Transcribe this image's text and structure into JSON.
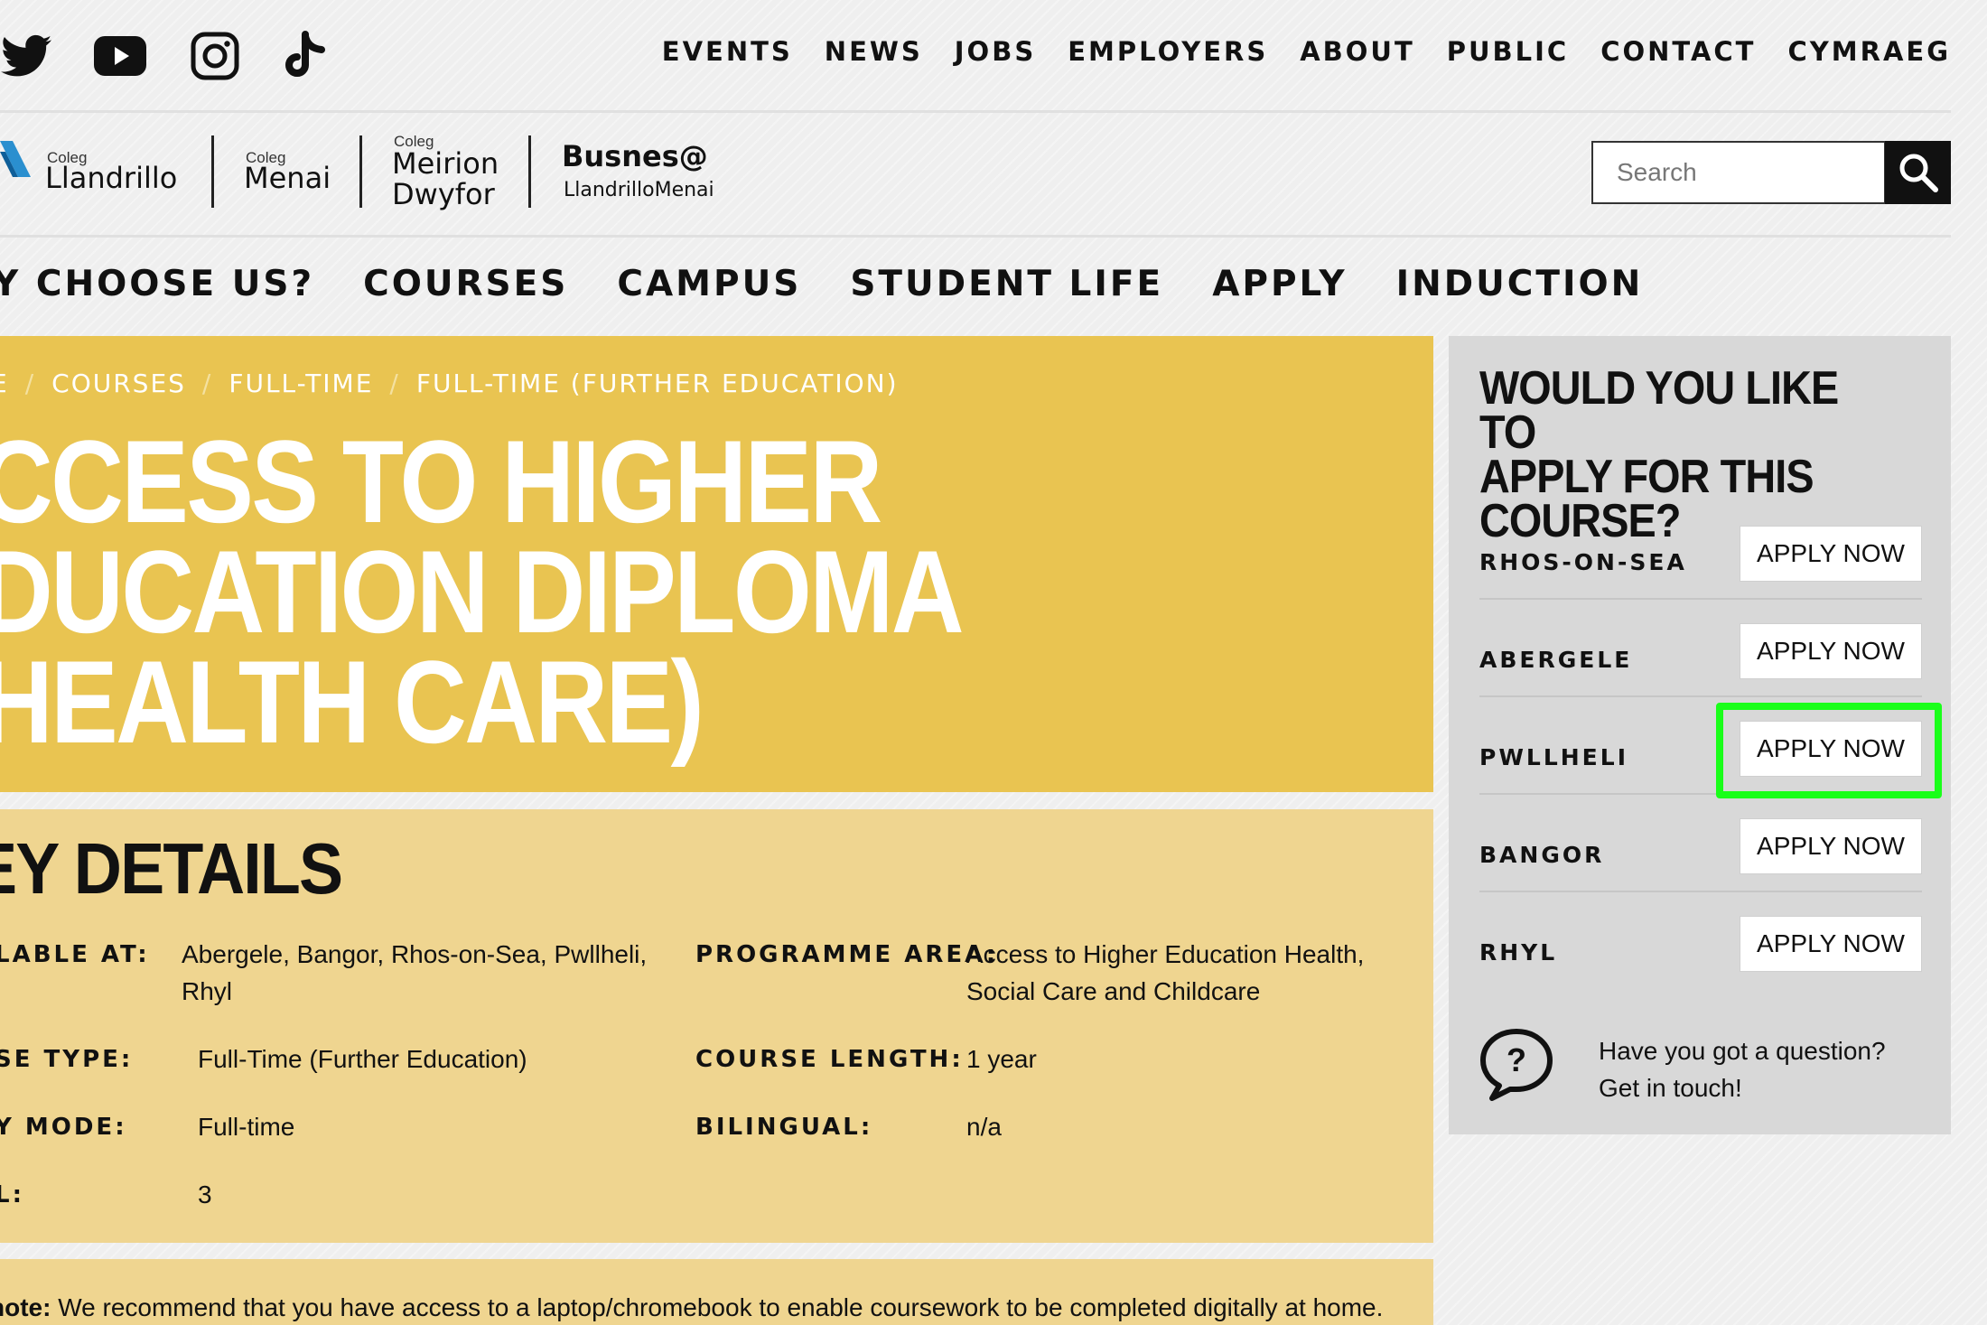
{
  "social": {
    "twitter": "twitter-icon",
    "youtube": "youtube-icon",
    "instagram": "instagram-icon",
    "tiktok": "tiktok-icon"
  },
  "topnav": [
    "EVENTS",
    "NEWS",
    "JOBS",
    "EMPLOYERS",
    "ABOUT",
    "PUBLIC",
    "CONTACT",
    "CYMRAEG"
  ],
  "logos": {
    "llandrillo": {
      "small": "Coleg",
      "name": "Llandrillo"
    },
    "menai": {
      "small": "Coleg",
      "name": "Menai"
    },
    "meirion": {
      "small": "Coleg",
      "line1": "Meirion",
      "line2": "Dwyfor"
    },
    "busnes": {
      "name": "Busnes@",
      "sub": "LlandrilloMenai"
    }
  },
  "search": {
    "placeholder": "Search",
    "button_icon": "search-icon"
  },
  "mainnav": [
    "Y CHOOSE US?",
    "COURSES",
    "CAMPUS",
    "STUDENT LIFE",
    "APPLY",
    "INDUCTION"
  ],
  "breadcrumb": {
    "first": "E",
    "sep": "/",
    "items": [
      "COURSES",
      "FULL-TIME",
      "FULL-TIME (FURTHER EDUCATION)"
    ]
  },
  "hero": {
    "title_lines": [
      "CCESS TO HIGHER",
      "DUCATION DIPLOMA",
      "HEALTH CARE)"
    ]
  },
  "key_details": {
    "heading": "EY DETAILS",
    "rows": [
      {
        "label": "LABLE AT:",
        "value": "Abergele, Bangor, Rhos-on-Sea, Pwllheli, Rhyl"
      },
      {
        "label": "SE TYPE:",
        "value": "Full-Time (Further Education)"
      },
      {
        "label": "Y MODE:",
        "value": "Full-time"
      },
      {
        "label": "L:",
        "value": "3"
      }
    ],
    "right_rows": [
      {
        "label": "PROGRAMME AREA:",
        "value": "Access to Higher Education Health, Social Care and Childcare"
      },
      {
        "label": "COURSE LENGTH:",
        "value": "1 year"
      },
      {
        "label": "BILINGUAL:",
        "value": "n/a"
      }
    ]
  },
  "note": {
    "bold": "note:",
    "text": " We recommend that you have access to a laptop/chromebook to enable coursework to be completed digitally at home."
  },
  "sidebar": {
    "title_lines": [
      "WOULD YOU LIKE TO",
      "APPLY FOR THIS",
      "COURSE?"
    ],
    "campuses": [
      {
        "name": "RHOS-ON-SEA",
        "button": "APPLY NOW"
      },
      {
        "name": "ABERGELE",
        "button": "APPLY NOW"
      },
      {
        "name": "PWLLHELI",
        "button": "APPLY NOW"
      },
      {
        "name": "BANGOR",
        "button": "APPLY NOW"
      },
      {
        "name": "RHYL",
        "button": "APPLY NOW"
      }
    ],
    "question_icon": "question-bubble-icon",
    "question_lines": [
      "Have you got a question?",
      "Get in touch!"
    ]
  },
  "colors": {
    "hero": "#e9c451",
    "details": "#efd590",
    "sidebar": "#d8d8d8",
    "highlight": "#1aff1a"
  }
}
